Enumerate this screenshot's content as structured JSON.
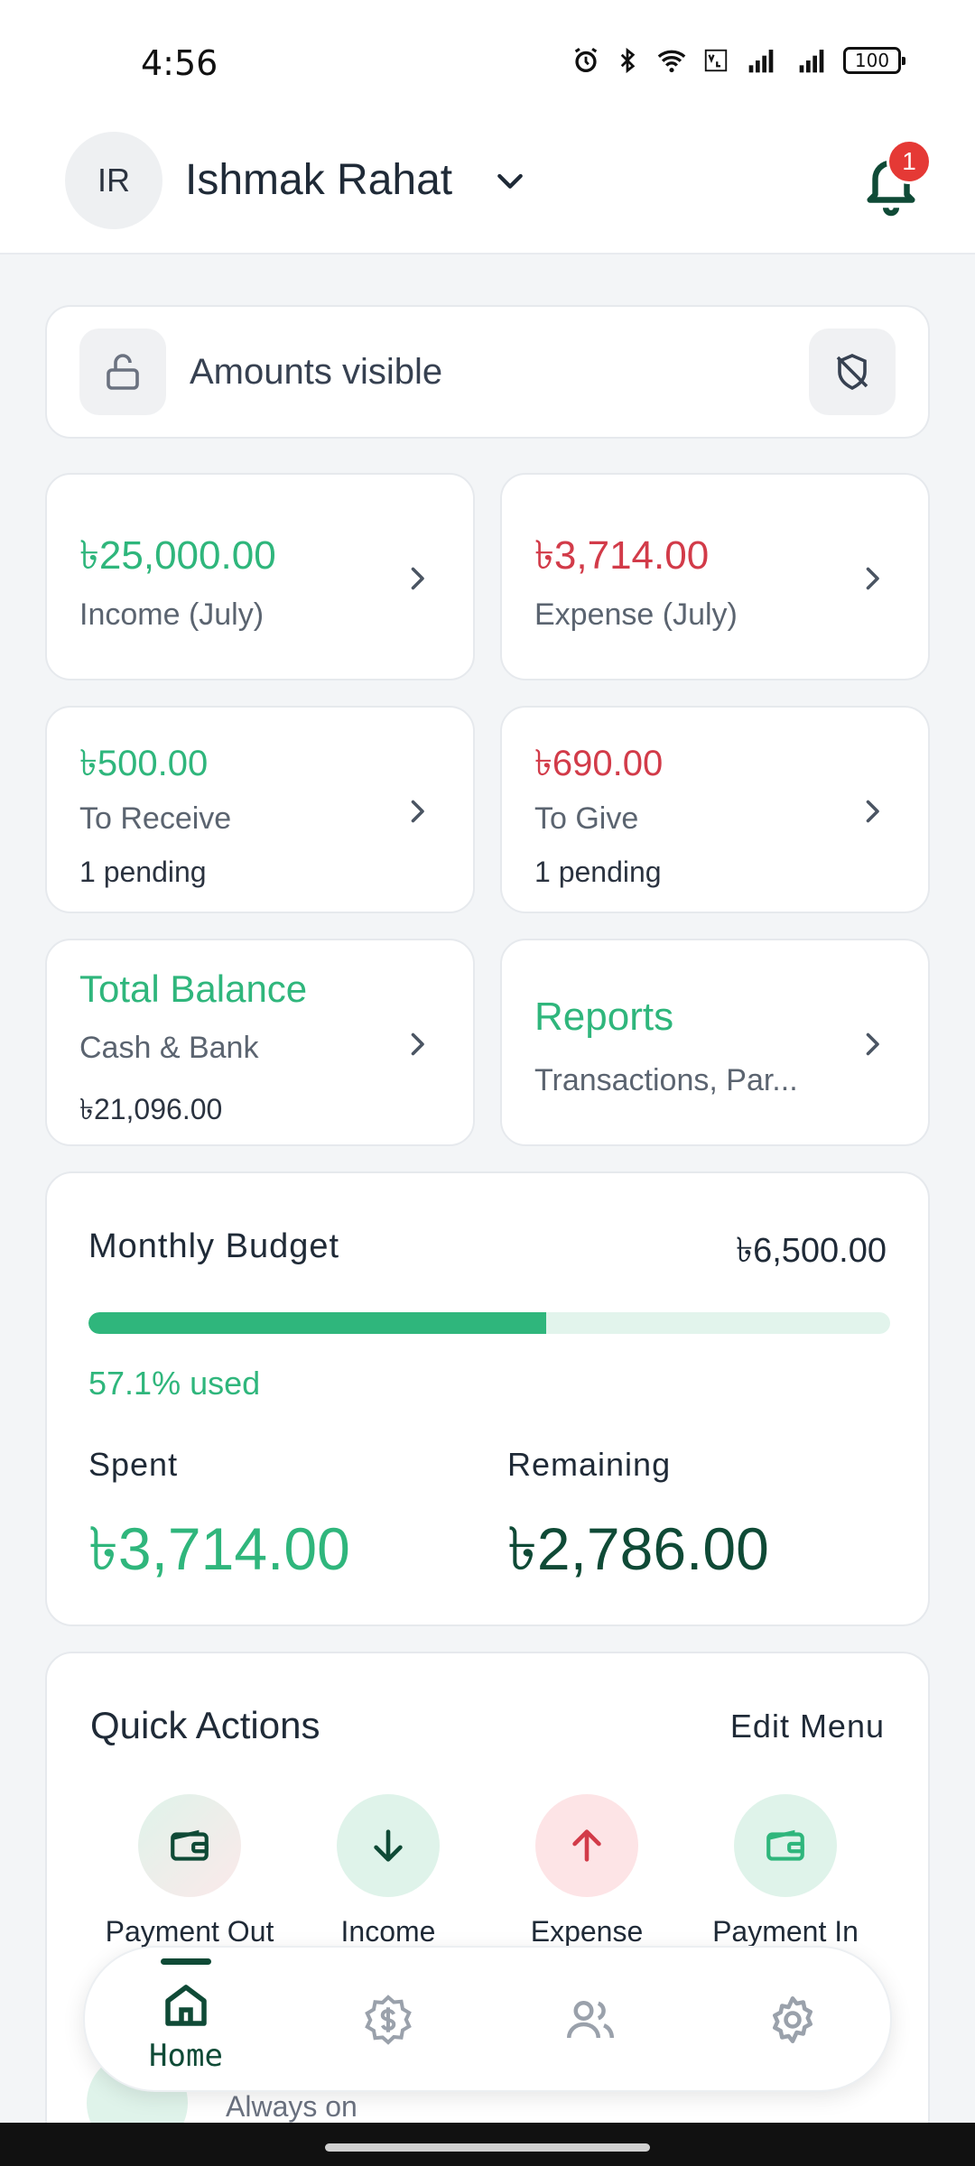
{
  "status_bar": {
    "time": "4:56",
    "battery": "100"
  },
  "header": {
    "avatar_initials": "IR",
    "user_name": "Ishmak Rahat",
    "notification_count": "1"
  },
  "privacy": {
    "label": "Amounts visible"
  },
  "stats": {
    "income": {
      "amount": "৳25,000.00",
      "label": "Income (July)"
    },
    "expense": {
      "amount": "৳3,714.00",
      "label": "Expense (July)"
    },
    "to_receive": {
      "amount": "৳500.00",
      "label": "To Receive",
      "pending": "1 pending"
    },
    "to_give": {
      "amount": "৳690.00",
      "label": "To Give",
      "pending": "1 pending"
    },
    "total_balance": {
      "title": "Total Balance",
      "label": "Cash & Bank",
      "amount": "৳21,096.00"
    },
    "reports": {
      "title": "Reports",
      "label": "Transactions, Par..."
    }
  },
  "budget": {
    "title": "Monthly Budget",
    "total": "৳6,500.00",
    "used_fraction": 0.571,
    "used_label": "57.1% used",
    "spent_label": "Spent",
    "spent": "৳3,714.00",
    "remaining_label": "Remaining",
    "remaining": "৳2,786.00"
  },
  "quick_actions": {
    "title": "Quick Actions",
    "edit_label": "Edit Menu",
    "items": [
      {
        "label": "Payment Out",
        "icon": "wallet-icon"
      },
      {
        "label": "Income",
        "icon": "arrow-down-icon"
      },
      {
        "label": "Expense",
        "icon": "arrow-up-icon"
      },
      {
        "label": "Payment In",
        "icon": "wallet-icon"
      }
    ]
  },
  "peek_row": {
    "subtitle": "Always on"
  },
  "nav": {
    "items": [
      {
        "label": "Home",
        "icon": "home-icon",
        "active": true
      },
      {
        "label": "",
        "icon": "dollar-icon"
      },
      {
        "label": "",
        "icon": "users-icon"
      },
      {
        "label": "",
        "icon": "gear-icon"
      }
    ]
  },
  "colors": {
    "green": "#2fb67c",
    "red": "#d23b49",
    "dark_green": "#0f4a36"
  }
}
